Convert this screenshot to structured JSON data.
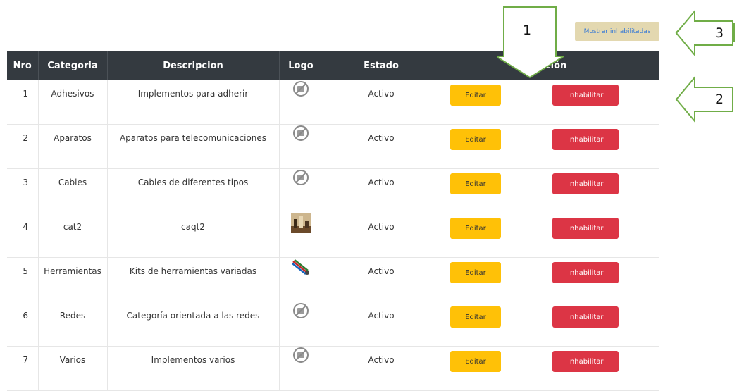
{
  "toolbar": {
    "show_disabled_label": "Mostrar inhabilitadas"
  },
  "table": {
    "headers": {
      "nro": "Nro",
      "categoria": "Categoria",
      "descripcion": "Descripcion",
      "logo": "Logo",
      "estado": "Estado",
      "accion": "Acción"
    },
    "rows": [
      {
        "nro": "1",
        "categoria": "Adhesivos",
        "descripcion": "Implementos para adherir",
        "logo": "no-image-icon",
        "estado": "Activo",
        "edit": "Editar",
        "disable": "Inhabilitar"
      },
      {
        "nro": "2",
        "categoria": "Aparatos",
        "descripcion": "Aparatos para telecomunicaciones",
        "logo": "no-image-icon",
        "estado": "Activo",
        "edit": "Editar",
        "disable": "Inhabilitar"
      },
      {
        "nro": "3",
        "categoria": "Cables",
        "descripcion": "Cables de diferentes tipos",
        "logo": "no-image-icon",
        "estado": "Activo",
        "edit": "Editar",
        "disable": "Inhabilitar"
      },
      {
        "nro": "4",
        "categoria": "cat2",
        "descripcion": "caqt2",
        "logo": "chess-photo",
        "estado": "Activo",
        "edit": "Editar",
        "disable": "Inhabilitar"
      },
      {
        "nro": "5",
        "categoria": "Herramientas",
        "descripcion": "Kits de herramientas variadas",
        "logo": "cable-photo",
        "estado": "Activo",
        "edit": "Editar",
        "disable": "Inhabilitar"
      },
      {
        "nro": "6",
        "categoria": "Redes",
        "descripcion": "Categoría orientada a las redes",
        "logo": "no-image-icon",
        "estado": "Activo",
        "edit": "Editar",
        "disable": "Inhabilitar"
      },
      {
        "nro": "7",
        "categoria": "Varios",
        "descripcion": "Implementos varios",
        "logo": "no-image-icon",
        "estado": "Activo",
        "edit": "Editar",
        "disable": "Inhabilitar"
      }
    ]
  },
  "annotations": {
    "one": "1",
    "two": "2",
    "three": "3"
  },
  "colors": {
    "header_bg": "#343a40",
    "edit_button": "#ffc107",
    "disable_button": "#dc3545",
    "show_disabled_button": "#e3d8b0",
    "callout_stroke": "#70ad47"
  }
}
